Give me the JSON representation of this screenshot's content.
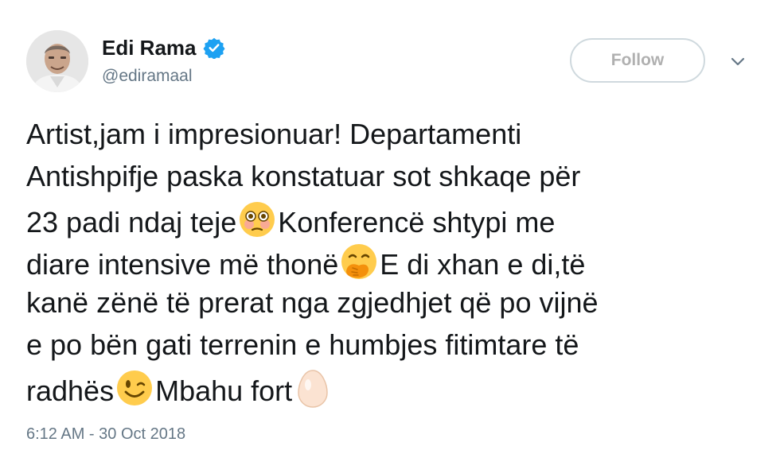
{
  "user": {
    "name": "Edi Rama",
    "handle": "@ediramaal",
    "verified": true
  },
  "actions": {
    "follow_label": "Follow",
    "menu_icon": "chevron-down-icon"
  },
  "tweet": {
    "lines": [
      [
        "Artist,jam i impresionuar! Departamenti"
      ],
      [
        "Antishpifje paska konstatuar sot shkaqe për"
      ],
      [
        "23 padi ndaj teje",
        {
          "emoji": "flushed-face"
        },
        "Konferencë shtypi me"
      ],
      [
        "diare intensive më thonë",
        {
          "emoji": "face-with-hand-over-mouth"
        },
        "E di xhan e di,të"
      ],
      [
        "kanë zënë të prerat nga zgjedhjet që po vijnë"
      ],
      [
        "e po bën gati terrenin e humbjes fitimtare të"
      ],
      [
        "radhës",
        {
          "emoji": "winking-face"
        },
        "Mbahu fort",
        {
          "emoji": "egg"
        }
      ]
    ],
    "timestamp": "6:12 AM - 30 Oct 2018"
  },
  "colors": {
    "text": "#14171a",
    "secondary": "#657786",
    "verified": "#1da1f2",
    "border": "#cfd9de"
  }
}
